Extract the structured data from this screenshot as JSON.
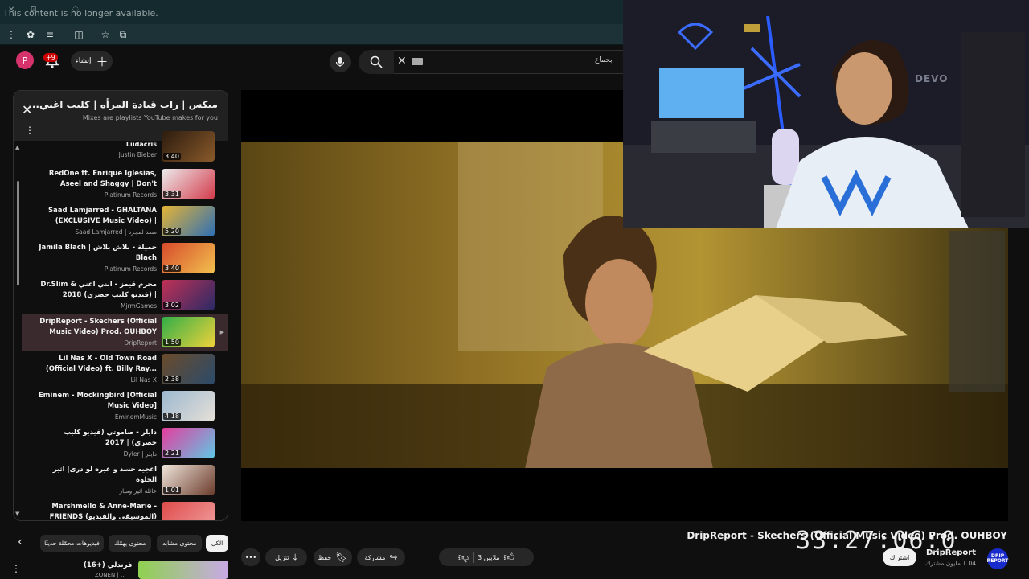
{
  "browser": {
    "notice": "This content is no longer available.",
    "toolbar_icons": [
      "kebab-icon",
      "extension-puzzle-icon",
      "queue-icon",
      "sidepanel-icon",
      "star-icon",
      "tab-icon"
    ]
  },
  "header": {
    "avatar_letter": "P",
    "notifications_badge": "+9",
    "create_label": "إنشاء",
    "search_text": "بحماع"
  },
  "playlist": {
    "title": "ميكس | راب قيادة المرأه | كليب اغني...",
    "subtitle": "Mixes are playlists YouTube makes for you",
    "items": [
      {
        "title": "Ludacris",
        "channel": "Justin Bieber",
        "duration": "3:40",
        "colors": [
          "#2b1b0e",
          "#8a5a2b"
        ]
      },
      {
        "title": "RedOne ft. Enrique Iglesias, Aseel and Shaggy | Don't You...",
        "channel": "Platinum Records",
        "duration": "3:31",
        "colors": [
          "#ececec",
          "#d33a4a"
        ]
      },
      {
        "title": "Saad Lamjarred - GHALTANA (EXCLUSIVE Music Video) | (سـ...",
        "channel": "Saad Lamjarred | سعد لمجرد",
        "duration": "5:20",
        "colors": [
          "#e7b434",
          "#2d6fb6"
        ]
      },
      {
        "title": "Jamila Blach | جميلة - بلاش بلاش Blach",
        "channel": "Platinum Records",
        "duration": "3:40",
        "colors": [
          "#d74a2c",
          "#f2c14e"
        ]
      },
      {
        "title": "Dr.Slim & مجرم قيمز - ابني اعني | (فيديو كليب حصري) 2018",
        "channel": "MjrmGames",
        "duration": "3:02",
        "colors": [
          "#c23155",
          "#2a2a66"
        ]
      },
      {
        "title": "DripReport - Skechers (Official Music Video) Prod. OUHBOY",
        "channel": "DripReport",
        "duration": "1:50",
        "colors": [
          "#2fae48",
          "#f0d23a"
        ]
      },
      {
        "title": "Lil Nas X - Old Town Road (Official Video) ft. Billy Ray...",
        "channel": "Lil Nas X",
        "duration": "2:38",
        "colors": [
          "#6b4b2a",
          "#2b4b6b"
        ]
      },
      {
        "title": "Eminem - Mockingbird [Official Music Video]",
        "channel": "EminemMusic",
        "duration": "4:18",
        "colors": [
          "#9bb8cf",
          "#e6e0d8"
        ]
      },
      {
        "title": "دايلر - صاموتي (فيديو كليب حصري) | 2017",
        "channel": "Dyler | دايلر",
        "duration": "2:21",
        "colors": [
          "#e63c9c",
          "#5fc7e6"
        ]
      },
      {
        "title": "اعجيه حسد و عيره لو درى| اثير الحلوه",
        "channel": "عائلة اثير وميار",
        "duration": "1:01",
        "colors": [
          "#f0e6dc",
          "#6b3b2b"
        ]
      },
      {
        "title": "Marshmello & Anne-Marie - FRIENDS (الموسيقى والفيديو) *...",
        "channel": "",
        "duration": "",
        "colors": [
          "#e04a4a",
          "#f0a0a0"
        ]
      }
    ]
  },
  "video": {
    "title": "DripReport - Skechers (Official Music Video) Prod. OUHBOY",
    "channel": "DripReport",
    "subscribers": "1.04 مليون مشترك",
    "subscribe_label": "اشتراك",
    "channel_avatar_text": "DRIP REPORT",
    "timer": "33:27:06:0"
  },
  "actions": {
    "likes": "3 ملايين",
    "share": "مشاركة",
    "save": "حفظ",
    "download": "تنزيل"
  },
  "chips": [
    "الكل",
    "محتوى مشابه",
    "محتوى يهمّك",
    "فيديوهات محمّلة حديثًا"
  ],
  "recommendation": {
    "title": "فرندلي (+16)",
    "channel": "ZONEN | ..."
  },
  "webcam": {
    "brand": "DEVO"
  }
}
